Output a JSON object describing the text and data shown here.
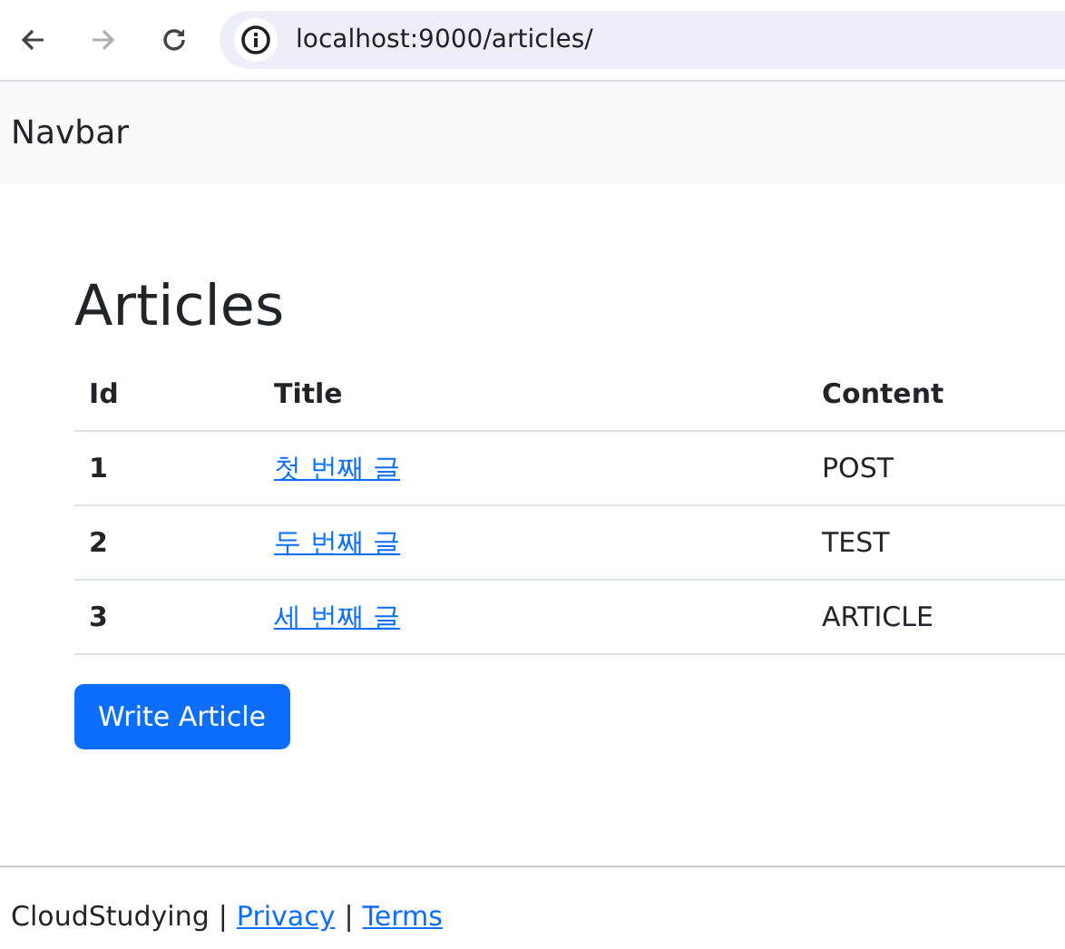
{
  "browser": {
    "back": {
      "disabled": false
    },
    "forward": {
      "disabled": true
    },
    "url": "localhost:9000/articles/"
  },
  "navbar": {
    "brand": "Navbar"
  },
  "heading": "Articles",
  "table": {
    "columns": [
      "Id",
      "Title",
      "Content"
    ],
    "rows": [
      {
        "id": "1",
        "title": "첫 번째 글",
        "content": "POST"
      },
      {
        "id": "2",
        "title": "두 번째 글",
        "content": "TEST"
      },
      {
        "id": "3",
        "title": "세 번째 글",
        "content": "ARTICLE"
      }
    ]
  },
  "button": "Write Article",
  "footer": [
    {
      "kind": "text",
      "text": "CloudStudying"
    },
    {
      "kind": "separator",
      "text": "|"
    },
    {
      "kind": "link",
      "text": "Privacy"
    },
    {
      "kind": "separator",
      "text": "|"
    },
    {
      "kind": "link",
      "text": "Terms"
    }
  ]
}
